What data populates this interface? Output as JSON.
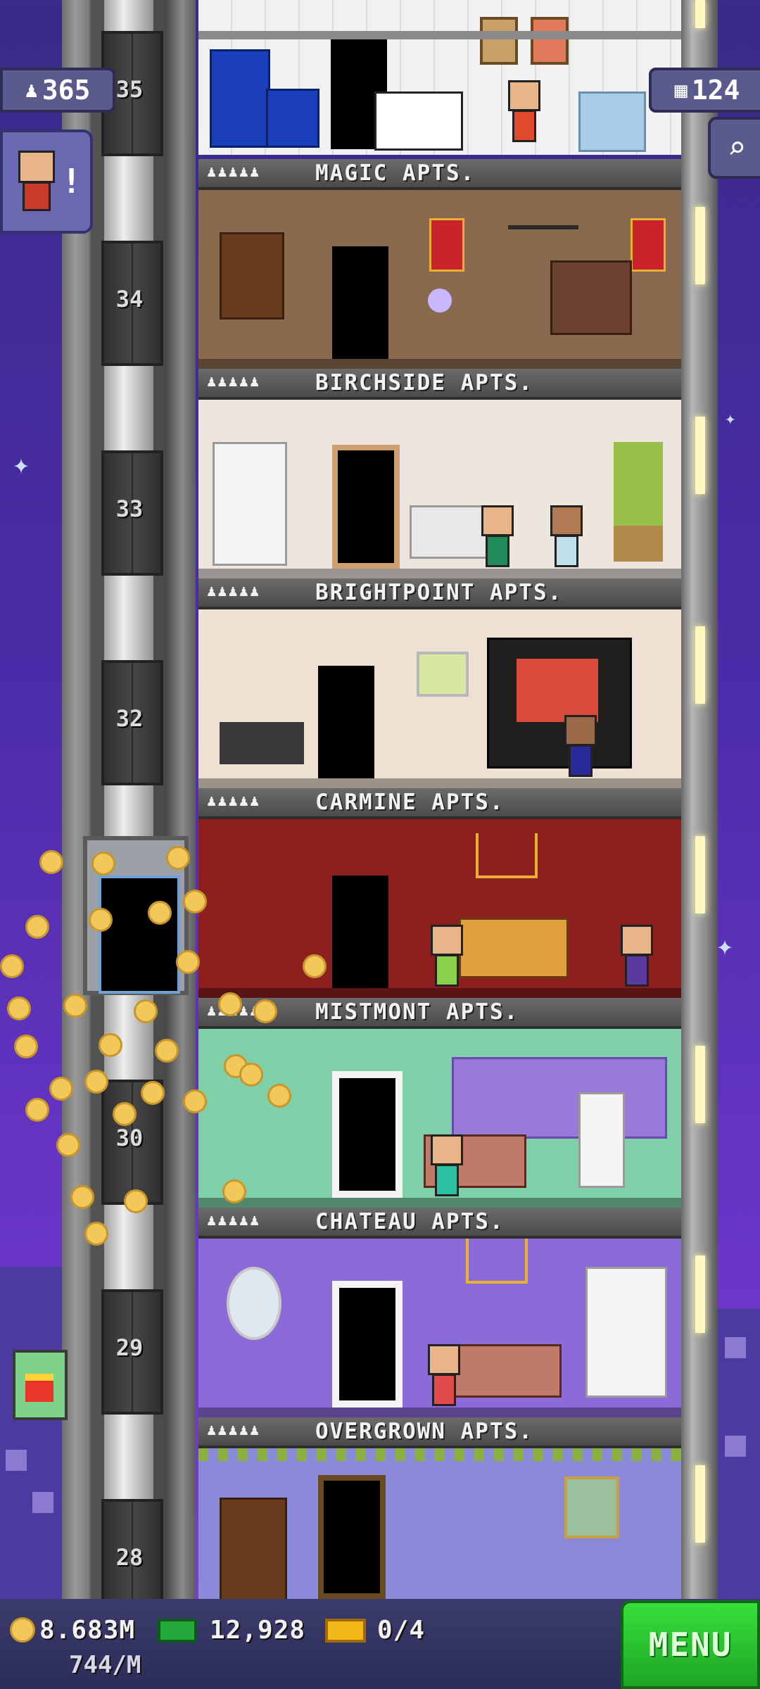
{
  "hud": {
    "population": "365",
    "floors": "124",
    "coins": "8.683M",
    "coin_rate": "744/M",
    "bux": "12,928",
    "tickets": "0/4",
    "menu_label": "MENU"
  },
  "floor_numbers": [
    "35",
    "34",
    "33",
    "32",
    "30",
    "29",
    "28"
  ],
  "floors": [
    {
      "name": "MAGIC APTS.",
      "people": "♟♟♟♟♟",
      "bg": "#8a6a4f"
    },
    {
      "name": "BIRCHSIDE APTS.",
      "people": "♟♟♟♟♟",
      "bg": "#ece6df"
    },
    {
      "name": "BRIGHTPOINT APTS.",
      "people": "♟♟♟♟♟",
      "bg": "#eee0d2"
    },
    {
      "name": "CARMINE APTS.",
      "people": "♟♟♟♟♟",
      "bg": "#8d1f1f"
    },
    {
      "name": "MISTMONT APTS.",
      "people": "♟♟♟♟♟",
      "bg": "#7fcfa8"
    },
    {
      "name": "CHATEAU APTS.",
      "people": "♟♟♟♟♟",
      "bg": "#8a6bd8"
    },
    {
      "name": "OVERGROWN APTS.",
      "people": "♟♟♟♟♟",
      "bg": "#8a8ad8"
    }
  ],
  "icons": {
    "population": "person-icon",
    "floors": "building-icon",
    "coins": "coin-icon",
    "bux": "bux-icon",
    "tickets": "ticket-icon",
    "search": "magnifier-icon"
  }
}
